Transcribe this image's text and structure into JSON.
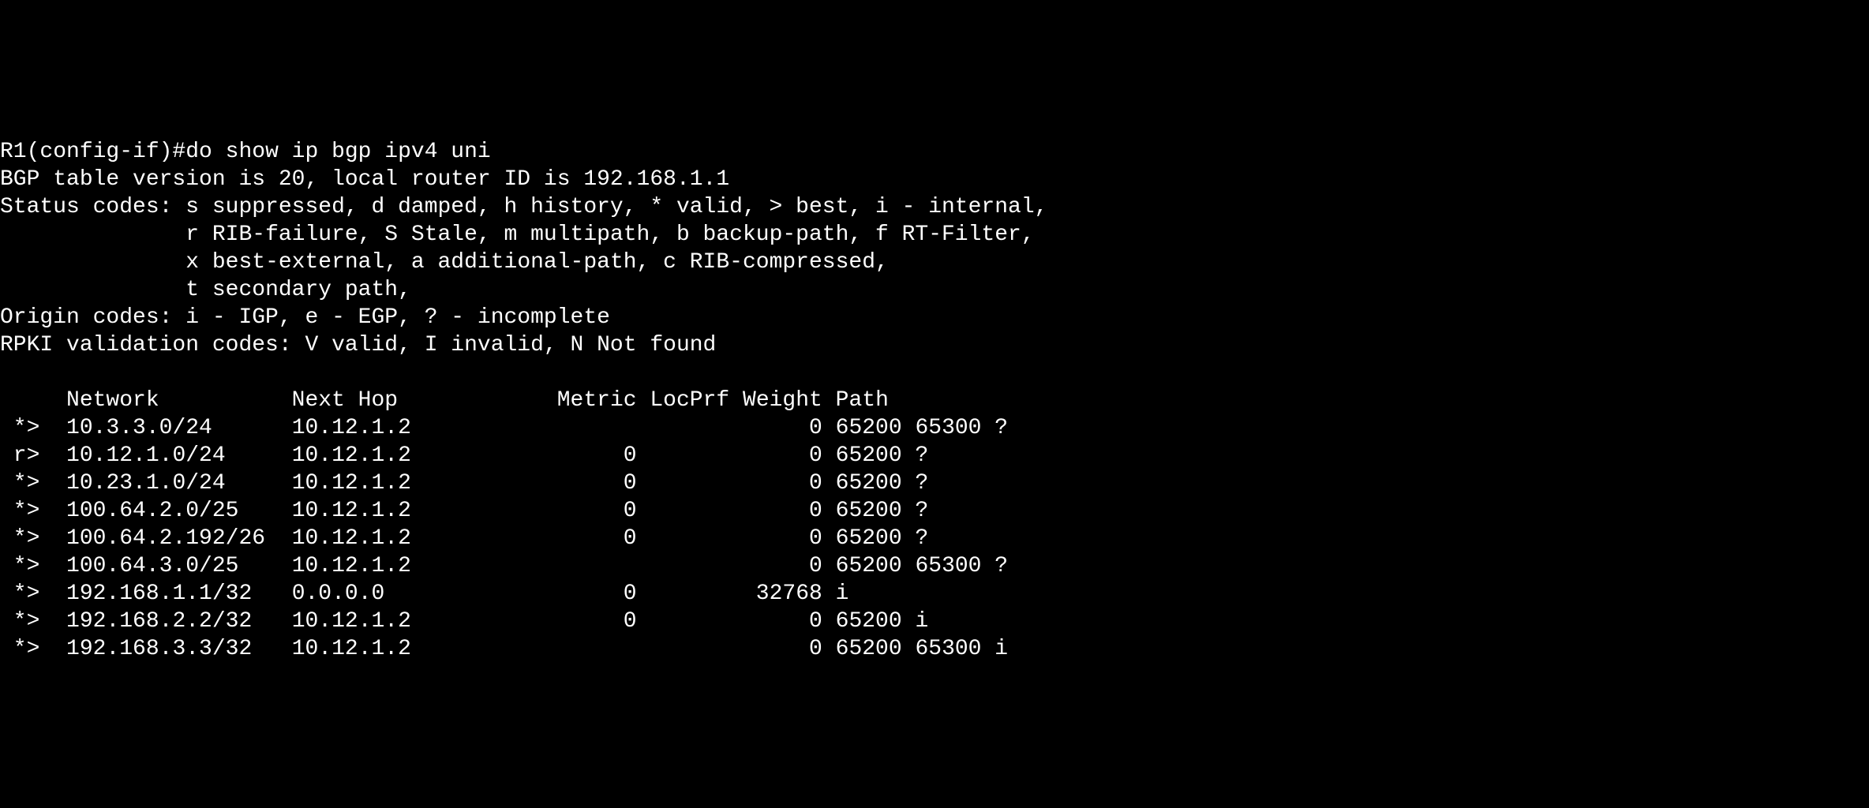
{
  "prompt": "R1(config-if)#",
  "command": "do show ip bgp ipv4 uni",
  "header": {
    "table_version_line": "BGP table version is 20, local router ID is 192.168.1.1",
    "status_codes_label": "Status codes:",
    "status_codes_1": " s suppressed, d damped, h history, * valid, > best, i - internal,",
    "status_codes_2": "r RIB-failure, S Stale, m multipath, b backup-path, f RT-Filter,",
    "status_codes_3": "x best-external, a additional-path, c RIB-compressed,",
    "status_codes_4": "t secondary path,",
    "origin_codes_line": "Origin codes: i - IGP, e - EGP, ? - incomplete",
    "rpki_line": "RPKI validation codes: V valid, I invalid, N Not found"
  },
  "columns": {
    "network": "Network",
    "next_hop": "Next Hop",
    "metric": "Metric",
    "locprf": "LocPrf",
    "weight": "Weight",
    "path": "Path"
  },
  "routes": [
    {
      "status": " *>",
      "network": "10.3.3.0/24",
      "next_hop": "10.12.1.2",
      "metric": "",
      "locprf": "",
      "weight": "0",
      "path": "65200 65300 ?"
    },
    {
      "status": " r>",
      "network": "10.12.1.0/24",
      "next_hop": "10.12.1.2",
      "metric": "0",
      "locprf": "",
      "weight": "0",
      "path": "65200 ?"
    },
    {
      "status": " *>",
      "network": "10.23.1.0/24",
      "next_hop": "10.12.1.2",
      "metric": "0",
      "locprf": "",
      "weight": "0",
      "path": "65200 ?"
    },
    {
      "status": " *>",
      "network": "100.64.2.0/25",
      "next_hop": "10.12.1.2",
      "metric": "0",
      "locprf": "",
      "weight": "0",
      "path": "65200 ?"
    },
    {
      "status": " *>",
      "network": "100.64.2.192/26",
      "next_hop": "10.12.1.2",
      "metric": "0",
      "locprf": "",
      "weight": "0",
      "path": "65200 ?"
    },
    {
      "status": " *>",
      "network": "100.64.3.0/25",
      "next_hop": "10.12.1.2",
      "metric": "",
      "locprf": "",
      "weight": "0",
      "path": "65200 65300 ?"
    },
    {
      "status": " *>",
      "network": "192.168.1.1/32",
      "next_hop": "0.0.0.0",
      "metric": "0",
      "locprf": "",
      "weight": "32768",
      "path": "i"
    },
    {
      "status": " *>",
      "network": "192.168.2.2/32",
      "next_hop": "10.12.1.2",
      "metric": "0",
      "locprf": "",
      "weight": "0",
      "path": "65200 i"
    },
    {
      "status": " *>",
      "network": "192.168.3.3/32",
      "next_hop": "10.12.1.2",
      "metric": "",
      "locprf": "",
      "weight": "0",
      "path": "65200 65300 i"
    }
  ]
}
